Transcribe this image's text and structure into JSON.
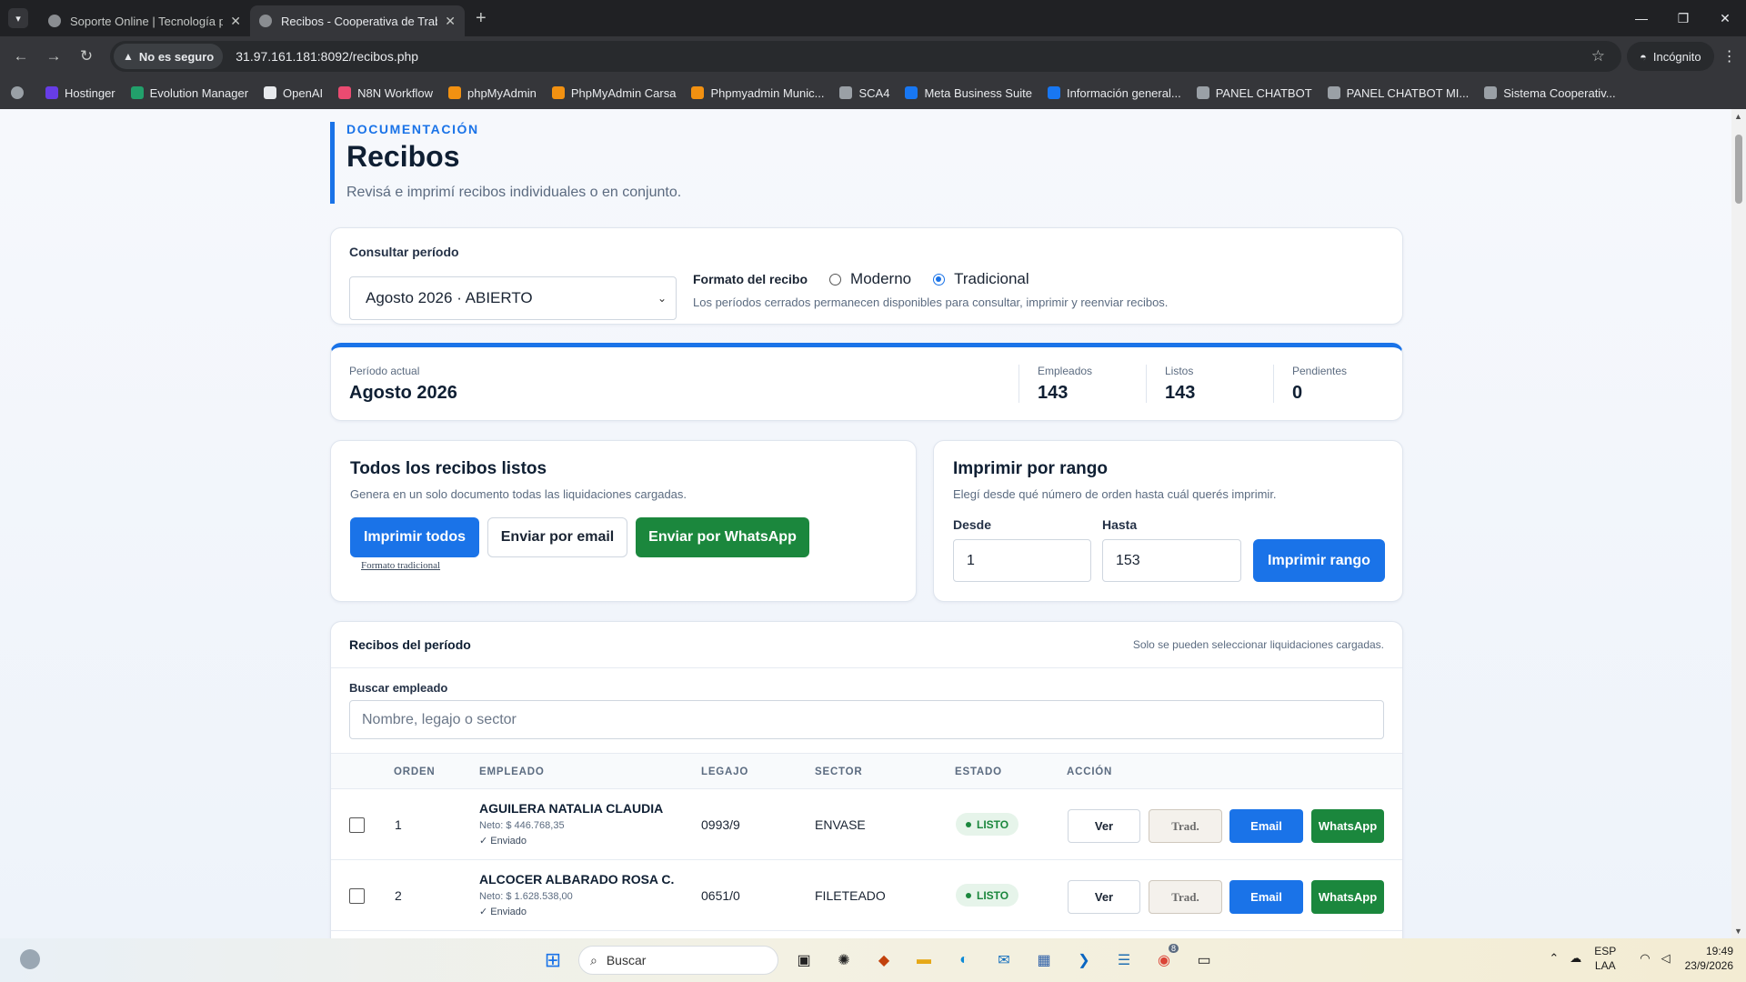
{
  "browser": {
    "tabs": [
      {
        "title": "Soporte Online | Tecnología para"
      },
      {
        "title": "Recibos - Cooperativa de Trabajo"
      }
    ],
    "security_label": "No es seguro",
    "url": "31.97.161.181:8092/recibos.php",
    "incognito_label": "Incógnito",
    "bookmarks": [
      {
        "label": "Hostinger",
        "color": "#673de6"
      },
      {
        "label": "Evolution Manager",
        "color": "#22a06b"
      },
      {
        "label": "OpenAI",
        "color": "#e8eaed"
      },
      {
        "label": "N8N Workflow",
        "color": "#ea4b71"
      },
      {
        "label": "phpMyAdmin",
        "color": "#f29111"
      },
      {
        "label": "PhpMyAdmin Carsa",
        "color": "#f29111"
      },
      {
        "label": "Phpmyadmin Munic...",
        "color": "#f29111"
      },
      {
        "label": "SCA4",
        "color": "#9aa0a6"
      },
      {
        "label": "Meta Business Suite",
        "color": "#1877f2"
      },
      {
        "label": "Información general...",
        "color": "#1877f2"
      },
      {
        "label": "PANEL CHATBOT",
        "color": "#9aa0a6"
      },
      {
        "label": "PANEL CHATBOT MI...",
        "color": "#9aa0a6"
      },
      {
        "label": "Sistema Cooperativ...",
        "color": "#9aa0a6"
      }
    ]
  },
  "page": {
    "eyebrow": "DOCUMENTACIÓN",
    "title": "Recibos",
    "subtitle": "Revisá e imprimí recibos individuales o en conjunto."
  },
  "periodo": {
    "label": "Consultar período",
    "selected": "Agosto 2026 · ABIERTO",
    "format_label": "Formato del recibo",
    "options": [
      "Moderno",
      "Tradicional"
    ],
    "selected_option": "Tradicional",
    "note": "Los períodos cerrados permanecen disponibles para consultar, imprimir y reenviar recibos."
  },
  "stats": {
    "current_label": "Período actual",
    "current_value": "Agosto 2026",
    "empleados_label": "Empleados",
    "empleados_value": "143",
    "listos_label": "Listos",
    "listos_value": "143",
    "pendientes_label": "Pendientes",
    "pendientes_value": "0"
  },
  "todos": {
    "title": "Todos los recibos listos",
    "desc": "Genera en un solo documento todas las liquidaciones cargadas.",
    "print_all": "Imprimir todos",
    "email": "Enviar por email",
    "whatsapp": "Enviar por WhatsApp",
    "format_link": "Formato tradicional"
  },
  "rango": {
    "title": "Imprimir por rango",
    "desc": "Elegí desde qué número de orden hasta cuál querés imprimir.",
    "desde_label": "Desde",
    "desde_value": "1",
    "hasta_label": "Hasta",
    "hasta_value": "153",
    "button": "Imprimir rango"
  },
  "tabla": {
    "title": "Recibos del período",
    "note": "Solo se pueden seleccionar liquidaciones cargadas.",
    "search_label": "Buscar empleado",
    "search_placeholder": "Nombre, legajo o sector",
    "columns": [
      "ORDEN",
      "EMPLEADO",
      "LEGAJO",
      "SECTOR",
      "ESTADO",
      "ACCIÓN"
    ],
    "rows": [
      {
        "orden": "1",
        "nombre": "AGUILERA NATALIA CLAUDIA",
        "neto": "Neto: $ 446.768,35",
        "enviado": "✓ Enviado",
        "legajo": "0993/9",
        "sector": "ENVASE",
        "estado": "LISTO"
      },
      {
        "orden": "2",
        "nombre": "ALCOCER ALBARADO ROSA C.",
        "neto": "Neto: $ 1.628.538,00",
        "enviado": "✓ Enviado",
        "legajo": "0651/0",
        "sector": "FILETEADO",
        "estado": "LISTO"
      }
    ],
    "actions": {
      "ver": "Ver",
      "trad": "Trad.",
      "email": "Email",
      "whatsapp": "WhatsApp"
    }
  },
  "taskbar": {
    "search": "Buscar",
    "lang_top": "ESP",
    "lang_bottom": "LAA",
    "time": "19:49",
    "date": "23/9/2026",
    "chrome_badge": "8"
  },
  "colors": {
    "accent": "#1a73e8",
    "success": "#1b873d"
  }
}
